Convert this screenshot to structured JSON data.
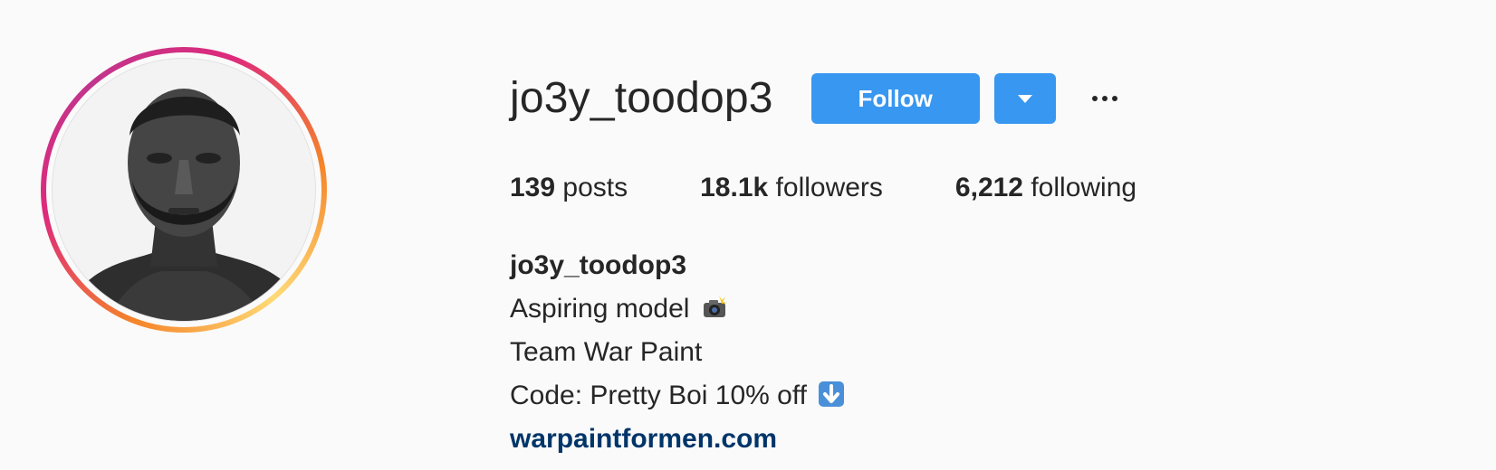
{
  "profile": {
    "username": "jo3y_toodop3",
    "follow_label": "Follow",
    "stats": {
      "posts_count": "139",
      "posts_label": "posts",
      "followers_count": "18.1k",
      "followers_label": "followers",
      "following_count": "6,212",
      "following_label": "following"
    },
    "bio": {
      "name": "jo3y_toodop3",
      "line1": "Aspiring model",
      "line1_emoji": "camera-flash-icon",
      "line2": "Team War Paint",
      "line3": "Code: Pretty Boi 10% off",
      "line3_emoji": "down-arrow-icon",
      "link": "warpaintformen.com"
    }
  },
  "colors": {
    "accent": "#3897f0",
    "link": "#003569",
    "text": "#262626",
    "background": "#fafafa"
  },
  "icons": [
    "avatar-photo",
    "chevron-down-icon",
    "more-options-icon",
    "camera-flash-icon",
    "down-arrow-icon"
  ]
}
